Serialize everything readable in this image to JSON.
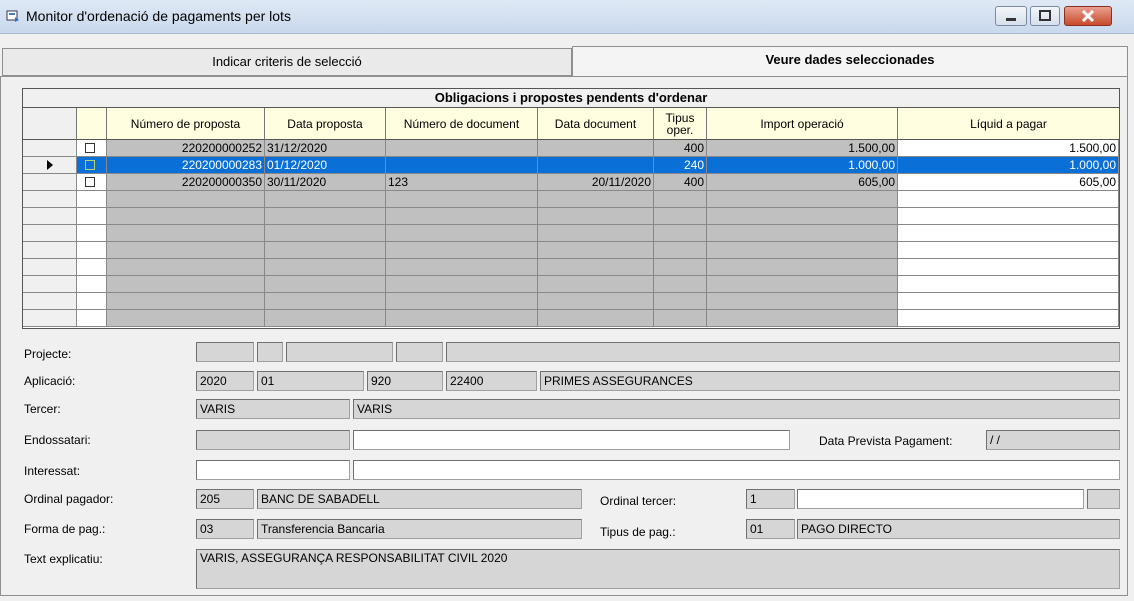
{
  "window": {
    "title": "Monitor d'ordenació de pagaments per lots"
  },
  "tabs": [
    {
      "label": "Indicar criteris de selecció",
      "active": false
    },
    {
      "label": "Veure dades seleccionades",
      "active": true
    }
  ],
  "grid": {
    "banner": "Obligacions i propostes pendents d'ordenar",
    "columns": [
      "Número de proposta",
      "Data proposta",
      "Número de document",
      "Data document",
      "Tipus oper.",
      "Import operació",
      "Líquid a pagar"
    ],
    "rows": [
      {
        "checked": false,
        "selected": false,
        "num_proposta": "220200000252",
        "data_proposta": "31/12/2020",
        "num_document": "",
        "data_document": "",
        "tipus": "400",
        "import": "1.500,00",
        "liquid": "1.500,00"
      },
      {
        "checked": false,
        "selected": true,
        "num_proposta": "220200000283",
        "data_proposta": "01/12/2020",
        "num_document": "",
        "data_document": "",
        "tipus": "240",
        "import": "1.000,00",
        "liquid": "1.000,00"
      },
      {
        "checked": false,
        "selected": false,
        "num_proposta": "220200000350",
        "data_proposta": "30/11/2020",
        "num_document": "123",
        "data_document": "20/11/2020",
        "tipus": "400",
        "import": "605,00",
        "liquid": "605,00"
      }
    ]
  },
  "details": {
    "projecte_label": "Projecte:",
    "aplicacio_label": "Aplicació:",
    "aplicacio": {
      "any": "2020",
      "organic": "01",
      "programa": "920",
      "economic": "22400",
      "descripcio": "PRIMES ASSEGURANCES"
    },
    "tercer_label": "Tercer:",
    "tercer": {
      "codi": "VARIS",
      "nom": "VARIS"
    },
    "endossatari_label": "Endossatari:",
    "data_prevista_label": "Data Prevista Pagament:",
    "data_prevista": " / /",
    "interessat_label": "Interessat:",
    "ordinal_pagador_label": "Ordinal pagador:",
    "ordinal_pagador": {
      "codi": "205",
      "nom": "BANC DE SABADELL"
    },
    "ordinal_tercer_label": "Ordinal tercer:",
    "ordinal_tercer": {
      "codi": "1",
      "valor": ""
    },
    "forma_pag_label": "Forma de pag.:",
    "forma_pag": {
      "codi": "03",
      "nom": "Transferencia Bancaria"
    },
    "tipus_pag_label": "Tipus de pag.:",
    "tipus_pag": {
      "codi": "01",
      "nom": "PAGO DIRECTO"
    },
    "text_explicatiu_label": "Text explicatiu:",
    "text_explicatiu": "VARIS, ASSEGURANÇA RESPONSABILITAT CIVIL 2020"
  }
}
